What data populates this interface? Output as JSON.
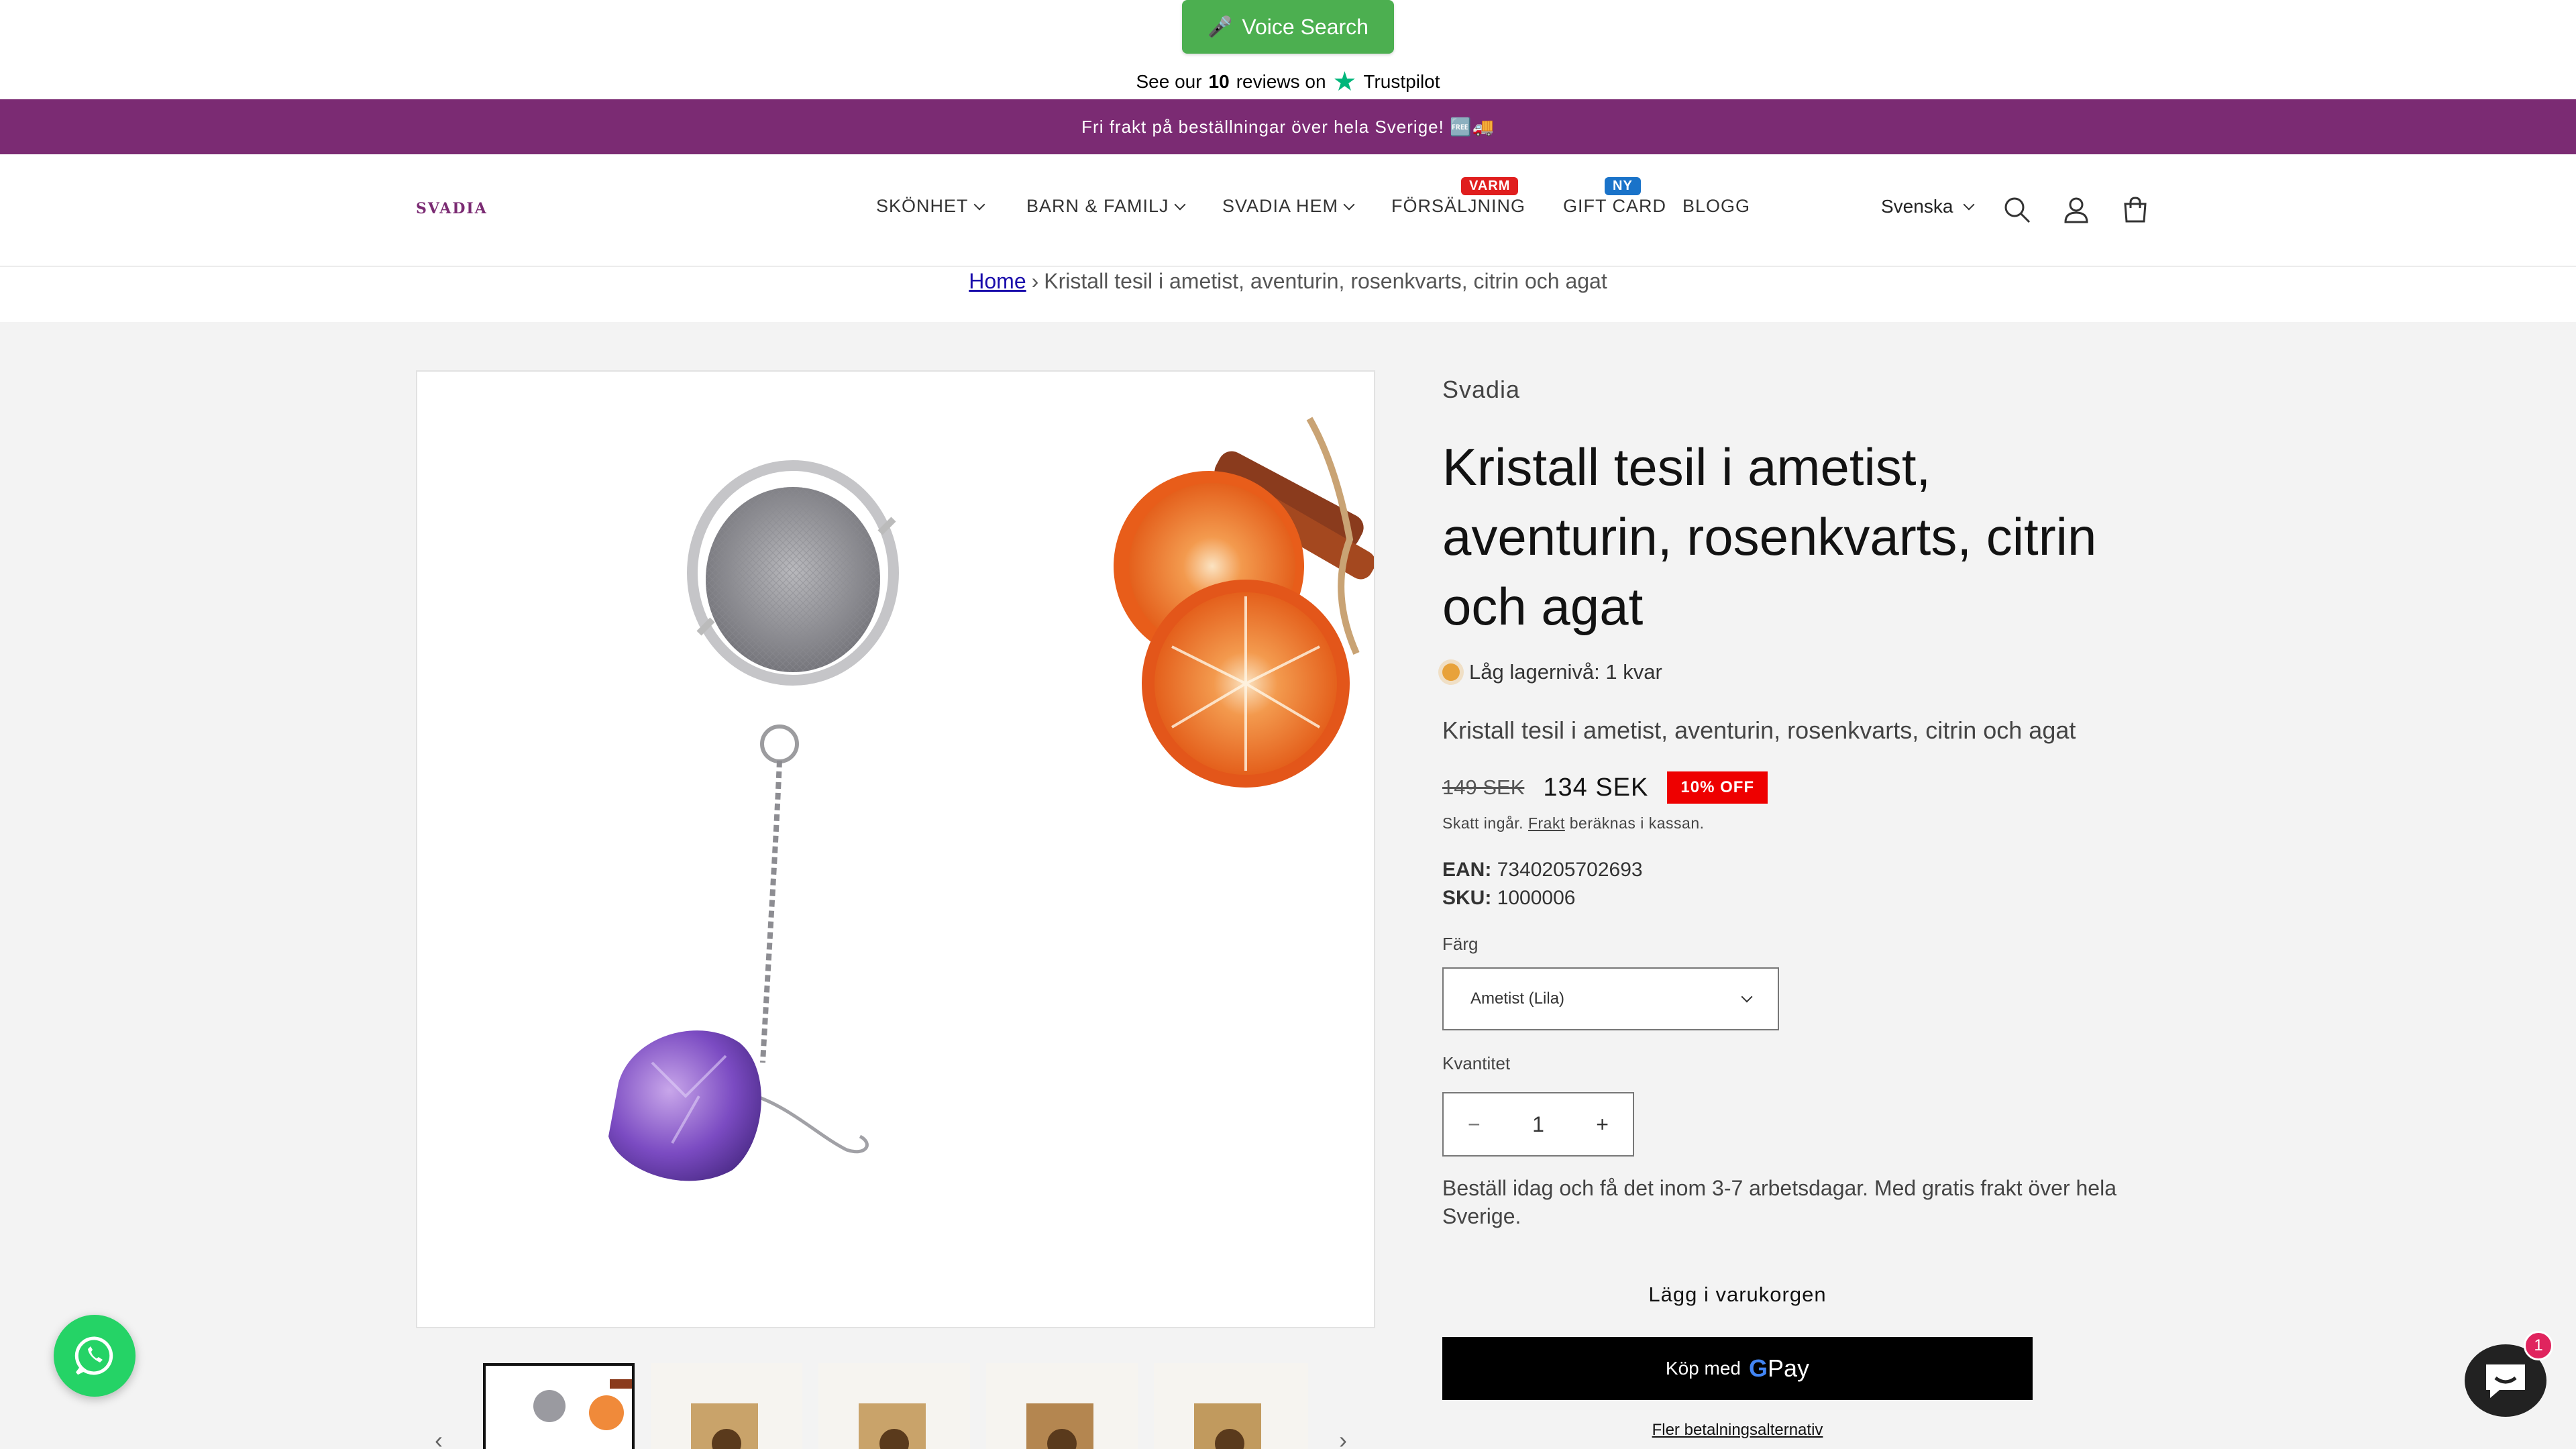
{
  "top_bar": {
    "voice_search_label": "Voice Search",
    "trustpilot_prefix": "See our",
    "trustpilot_count": "10",
    "trustpilot_mid": "reviews on",
    "trustpilot_brand": "Trustpilot"
  },
  "announcement": "Fri frakt på beställningar över hela Sverige! 🆓🚚",
  "header": {
    "logo": "SVADIA",
    "nav": [
      {
        "label": "SKÖNHET",
        "dropdown": true
      },
      {
        "label": "BARN & FAMILJ",
        "dropdown": true
      },
      {
        "label": "SVADIA HEM",
        "dropdown": true
      },
      {
        "label": "FÖRSÄLJNING",
        "badge": "VARM",
        "badge_color": "#e01e1e"
      },
      {
        "label": "GIFT CARD",
        "badge": "NY",
        "badge_color": "#1a73c9"
      },
      {
        "label": "BLOGG"
      }
    ],
    "language": "Svenska",
    "icons": [
      "search-icon",
      "account-icon",
      "cart-icon"
    ]
  },
  "breadcrumb": {
    "home": "Home",
    "separator": "›",
    "current": "Kristall tesil i ametist, aventurin, rosenkvarts, citrin och agat"
  },
  "product": {
    "vendor": "Svadia",
    "title": "Kristall tesil i ametist, aventurin, rosenkvarts, citrin och agat",
    "stock": "Låg lagernivå: 1 kvar",
    "description": "Kristall tesil i ametist, aventurin, rosenkvarts, citrin och agat",
    "old_price": "149 SEK",
    "price": "134 SEK",
    "discount": "10% OFF",
    "tax_prefix": "Skatt ingår.",
    "tax_link": "Frakt",
    "tax_suffix": "beräknas i kassan.",
    "ean_label": "EAN:",
    "ean": "7340205702693",
    "sku_label": "SKU:",
    "sku": "1000006",
    "color_label": "Färg",
    "color_value": "Ametist (Lila)",
    "quantity_label": "Kvantitet",
    "quantity": "1",
    "delivery": "Beställ idag och få det inom 3-7 arbetsdagar. Med gratis frakt över hela Sverige.",
    "add_to_cart": "Lägg i varukorgen",
    "gpay_prefix": "Köp med",
    "gpay_brand_g": "G",
    "gpay_brand_pay": "Pay",
    "more_payment": "Fler betalningsalternativ"
  },
  "chat": {
    "badge_count": "1"
  },
  "colors": {
    "accent": "#7b2b73",
    "voice": "#4caf50",
    "discount": "#e00000",
    "whatsapp": "#25d366"
  }
}
